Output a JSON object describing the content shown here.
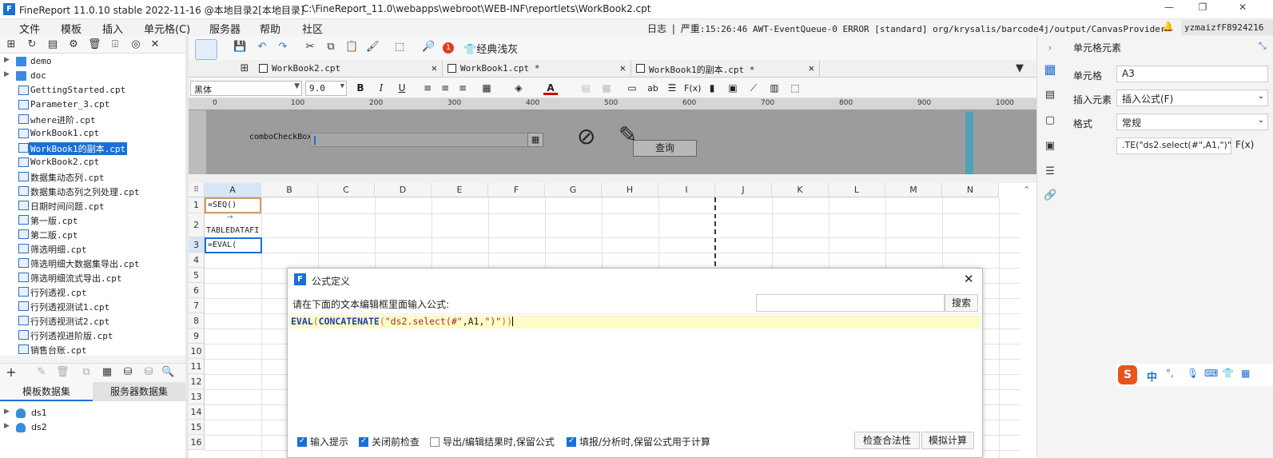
{
  "titlebar": {
    "app": "FineReport 11.0.10 stable 2022-11-16 @本地目录2[本地目录]",
    "path": "C:\\FineReport_11.0\\webapps\\webroot\\WEB-INF\\reportlets\\WorkBook2.cpt",
    "logo": "F"
  },
  "window_controls": {
    "minimize": "—",
    "maximize": "❐",
    "close": "✕"
  },
  "menu": [
    "文件",
    "模板",
    "插入",
    "单元格(C)",
    "服务器",
    "帮助",
    "社区"
  ],
  "log": {
    "label": "日志",
    "sep": "|",
    "level": "严重",
    "text": ":15:26:46 AWT-EventQueue-0 ERROR [standard] org/krysalis/barcode4j/output/CanvasProvider"
  },
  "user": "yzmaizfF8924216",
  "tree": {
    "items": [
      {
        "label": "demo",
        "type": "folder"
      },
      {
        "label": "doc",
        "type": "folder"
      },
      {
        "label": "GettingStarted.cpt",
        "type": "file"
      },
      {
        "label": "Parameter_3.cpt",
        "type": "file"
      },
      {
        "label": "where进阶.cpt",
        "type": "file"
      },
      {
        "label": "WorkBook1.cpt",
        "type": "file"
      },
      {
        "label": "WorkBook1的副本.cpt",
        "type": "file",
        "selected": true
      },
      {
        "label": "WorkBook2.cpt",
        "type": "file"
      },
      {
        "label": "数据集动态列.cpt",
        "type": "file"
      },
      {
        "label": "数据集动态列之列处理.cpt",
        "type": "file"
      },
      {
        "label": "日期时间问题.cpt",
        "type": "file"
      },
      {
        "label": "第一版.cpt",
        "type": "file"
      },
      {
        "label": "第二版.cpt",
        "type": "file"
      },
      {
        "label": "筛选明细.cpt",
        "type": "file"
      },
      {
        "label": "筛选明细大数据集导出.cpt",
        "type": "file"
      },
      {
        "label": "筛选明细流式导出.cpt",
        "type": "file"
      },
      {
        "label": "行列透视.cpt",
        "type": "file"
      },
      {
        "label": "行列透视测试1.cpt",
        "type": "file"
      },
      {
        "label": "行列透视测试2.cpt",
        "type": "file"
      },
      {
        "label": "行列透视进阶版.cpt",
        "type": "file"
      },
      {
        "label": "销售台账.cpt",
        "type": "file"
      }
    ]
  },
  "dataset_tabs": [
    "模板数据集",
    "服务器数据集"
  ],
  "datasets": [
    "ds1",
    "ds2"
  ],
  "toolbar": {
    "classic_label": "经典浅灰",
    "badge": "1"
  },
  "file_tabs": [
    {
      "label": "WorkBook2.cpt",
      "close": "✕"
    },
    {
      "label": "WorkBook1.cpt *",
      "close": "✕"
    },
    {
      "label": "WorkBook1的副本.cpt *",
      "close": "✕"
    }
  ],
  "format": {
    "font": "黑体",
    "size": "9.0"
  },
  "ruler": [
    "0",
    "100",
    "200",
    "300",
    "400",
    "500",
    "600",
    "700",
    "800",
    "900",
    "1000"
  ],
  "param": {
    "combo_label": "comboCheckBox",
    "query_button": "查询"
  },
  "columns": [
    "A",
    "B",
    "C",
    "D",
    "E",
    "F",
    "G",
    "H",
    "I",
    "J",
    "K",
    "L",
    "M",
    "N"
  ],
  "rows": [
    "1",
    "2",
    "3",
    "4",
    "5",
    "6",
    "7",
    "8",
    "9",
    "10",
    "11",
    "12",
    "13",
    "14",
    "15",
    "16"
  ],
  "cells": {
    "a1": "=SEQ()",
    "a2": "TABLEDATAFI",
    "a3": "=EVAL("
  },
  "right_panel": {
    "title": "单元格元素",
    "cell_label": "单元格",
    "cell_value": "A3",
    "insert_label": "插入元素",
    "insert_value": "插入公式(F)",
    "format_label": "格式",
    "format_value": "常规",
    "formula_preview": ".TE(\"ds2.select(#\",A1,\")\"))",
    "fx": "F(x)"
  },
  "dialog": {
    "title": "公式定义",
    "prompt": "请在下面的文本编辑框里面输入公式:",
    "search_placeholder": "",
    "search_button": "搜索",
    "formula_parts": {
      "f1": "EVAL",
      "p1": "(",
      "f2": "CONCATENATE",
      "p2": "(",
      "s1": "\"ds2.select(#\"",
      "c1": ",A1,",
      "s2": "\")\"",
      "p3": "))"
    },
    "options": [
      {
        "label": "输入提示",
        "checked": true
      },
      {
        "label": "关闭前检查",
        "checked": true
      },
      {
        "label": "导出/编辑结果时,保留公式",
        "checked": false
      },
      {
        "label": "填报/分析时,保留公式用于计算",
        "checked": true
      }
    ],
    "check_button": "检查合法性",
    "simulate_button": "模拟计算",
    "close": "✕"
  },
  "ime": {
    "zh": "中",
    "punct": "°,"
  },
  "colors": {
    "accent": "#1a6fd6",
    "formula_fn": "#1a3fb0",
    "formula_str": "#a03030",
    "formula_bg": "#fdfbc6",
    "param_bg": "#9c9c9c"
  }
}
